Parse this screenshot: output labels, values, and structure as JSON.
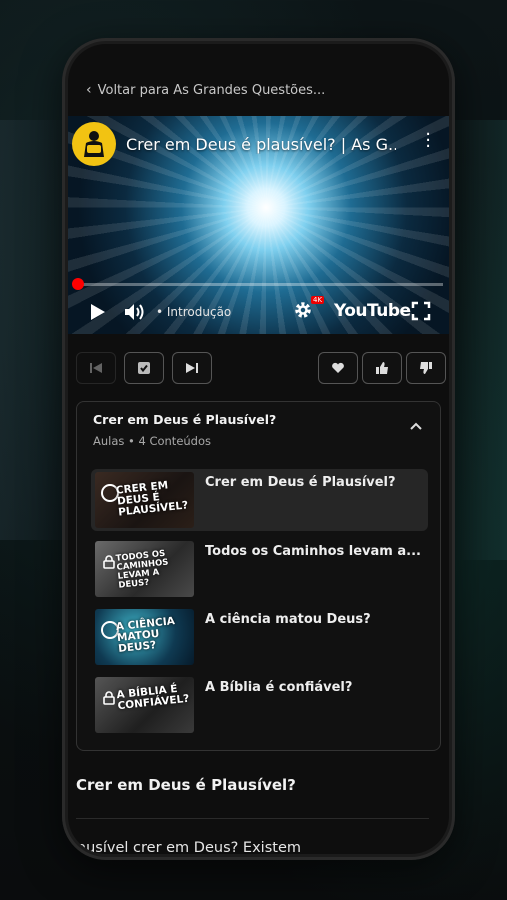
{
  "back_link": {
    "label": "Voltar para As Grandes Questões..."
  },
  "video": {
    "title": "Crer em Deus é plausível? | As G...",
    "chapter": "• Introdução",
    "brand": "YouTube",
    "quality_badge": "4K",
    "progress_fraction": 0.0
  },
  "course": {
    "title": "Crer em Deus é Plausível?",
    "subtitle": "Aulas • 4 Conteúdos",
    "lessons": [
      {
        "title": "Crer em Deus é Plausível?",
        "thumb_text": "CRER EM DEUS É PLAUSÍVEL?",
        "status": "in-progress",
        "active": true
      },
      {
        "title": "Todos os Caminhos levam a...",
        "thumb_text": "TODOS OS CAMINHOS LEVAM A DEUS?",
        "status": "locked",
        "active": false
      },
      {
        "title": "A ciência matou Deus?",
        "thumb_text": "A CIÊNCIA MATOU DEUS?",
        "status": "in-progress",
        "active": false
      },
      {
        "title": "A Bíblia é confiável?",
        "thumb_text": "A BÍBLIA É CONFIÁVEL?",
        "status": "locked",
        "active": false
      }
    ]
  },
  "section": {
    "title": "Crer em Deus é Plausível?"
  },
  "description": {
    "text": "plausível crer em Deus? Existem"
  },
  "colors": {
    "accent_red": "#ff0000",
    "channel_yellow": "#f2c312",
    "card_bg": "#111111",
    "active_row": "#262626"
  }
}
